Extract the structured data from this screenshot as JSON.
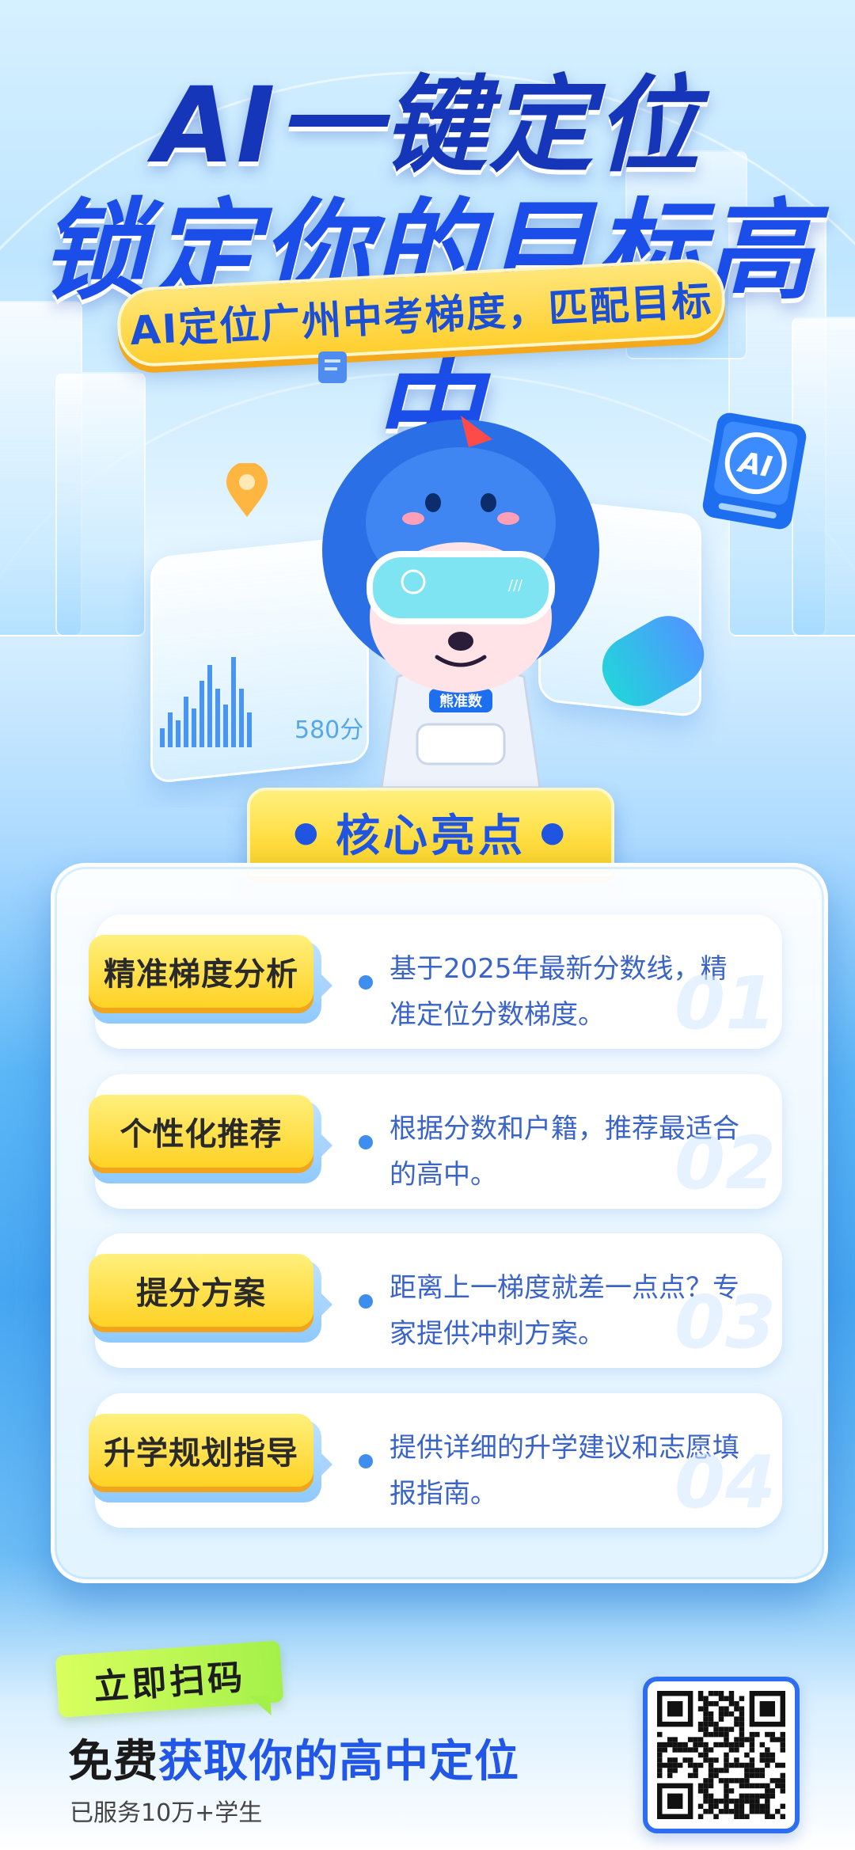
{
  "hero": {
    "title_line1": "AI一键定位",
    "title_line2": "锁定你的目标高中",
    "subtitle": "AI定位广州中考梯度，匹配目标",
    "score_label": "580分",
    "mascot_badge": "熊准数"
  },
  "highlights": {
    "heading": "核心亮点",
    "items": [
      {
        "label": "精准梯度分析",
        "desc": "基于2025年最新分数线，精准定位分数梯度。",
        "num": "01"
      },
      {
        "label": "个性化推荐",
        "desc": "根据分数和户籍，推荐最适合的高中。",
        "num": "02"
      },
      {
        "label": "提分方案",
        "desc": "距离上一梯度就差一点点？专家提供冲刺方案。",
        "num": "03"
      },
      {
        "label": "升学规划指导",
        "desc": "提供详细的升学建议和志愿填报指南。",
        "num": "04"
      }
    ]
  },
  "cta": {
    "tag": "立即扫码",
    "main_prefix": "免费",
    "main_highlight": "获取你的高中定位",
    "sub": "已服务10万+学生"
  },
  "colors": {
    "accent_blue": "#1f55e0",
    "yellow": "#ffd225",
    "green": "#a4f04a"
  }
}
